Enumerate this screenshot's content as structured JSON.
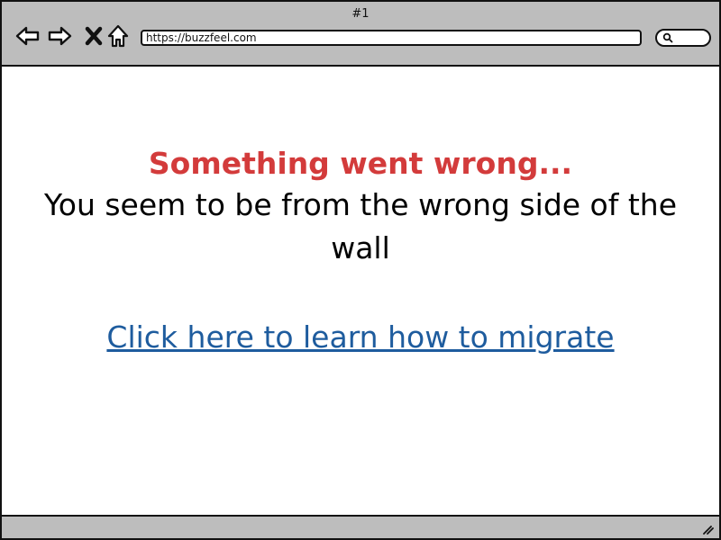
{
  "window": {
    "tab_title": "#1",
    "url": "https://buzzfeel.com"
  },
  "toolbar": {
    "back_icon": "back-arrow-icon",
    "forward_icon": "forward-arrow-icon",
    "stop_icon": "close-icon",
    "home_icon": "home-icon",
    "search_icon": "search-icon"
  },
  "content": {
    "error_title": "Something went wrong...",
    "error_body": "You seem to be from the wrong side of the wall",
    "link_text": "Click here to learn how to migrate"
  },
  "colors": {
    "chrome_gray": "#bdbdbd",
    "error_red": "#d33b3b",
    "link_blue": "#1e5c9e",
    "text_black": "#000000"
  }
}
